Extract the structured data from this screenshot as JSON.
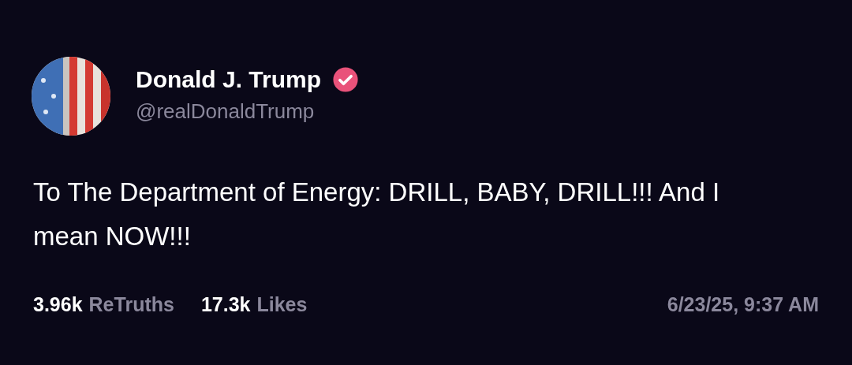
{
  "author": {
    "name": "Donald J. Trump",
    "verified": true,
    "handle": "@realDonaldTrump"
  },
  "post": {
    "text": "To The Department of Energy: DRILL, BABY, DRILL!!! And I mean NOW!!!"
  },
  "stats": [
    {
      "count": "3.96k",
      "label": "ReTruths"
    },
    {
      "count": "17.3k",
      "label": "Likes"
    }
  ],
  "timestamp": "6/23/25, 9:37 AM"
}
